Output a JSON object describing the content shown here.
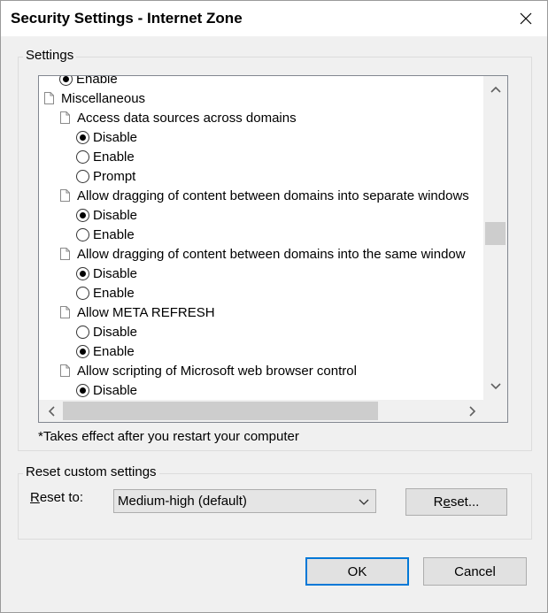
{
  "window": {
    "title": "Security Settings - Internet Zone"
  },
  "settings_group": {
    "label": "Settings",
    "tree": [
      {
        "type": "radio",
        "level": 1,
        "checked": true,
        "label": "Enable"
      },
      {
        "type": "doc",
        "level": 0,
        "label": "Miscellaneous"
      },
      {
        "type": "doc",
        "level": 1,
        "label": "Access data sources across domains"
      },
      {
        "type": "radio",
        "level": 2,
        "checked": true,
        "label": "Disable"
      },
      {
        "type": "radio",
        "level": 2,
        "checked": false,
        "label": "Enable"
      },
      {
        "type": "radio",
        "level": 2,
        "checked": false,
        "label": "Prompt"
      },
      {
        "type": "doc",
        "level": 1,
        "label": "Allow dragging of content between domains into separate windows"
      },
      {
        "type": "radio",
        "level": 2,
        "checked": true,
        "label": "Disable"
      },
      {
        "type": "radio",
        "level": 2,
        "checked": false,
        "label": "Enable"
      },
      {
        "type": "doc",
        "level": 1,
        "label": "Allow dragging of content between domains into the same window"
      },
      {
        "type": "radio",
        "level": 2,
        "checked": true,
        "label": "Disable"
      },
      {
        "type": "radio",
        "level": 2,
        "checked": false,
        "label": "Enable"
      },
      {
        "type": "doc",
        "level": 1,
        "label": "Allow META REFRESH"
      },
      {
        "type": "radio",
        "level": 2,
        "checked": false,
        "label": "Disable"
      },
      {
        "type": "radio",
        "level": 2,
        "checked": true,
        "label": "Enable"
      },
      {
        "type": "doc",
        "level": 1,
        "label": "Allow scripting of Microsoft web browser control"
      },
      {
        "type": "radio",
        "level": 2,
        "checked": true,
        "label": "Disable"
      }
    ],
    "note": "*Takes effect after you restart your computer"
  },
  "reset_group": {
    "label": "Reset custom settings",
    "reset_to_label_first": "R",
    "reset_to_label_rest": "eset to:",
    "selected_level": "Medium-high (default)",
    "reset_button_pre": "R",
    "reset_button_u": "e",
    "reset_button_post": "set..."
  },
  "buttons": {
    "ok": "OK",
    "cancel": "Cancel"
  },
  "icons": {
    "close": "close-icon",
    "scroll_up": "chevron-up-icon",
    "scroll_down": "chevron-down-icon",
    "scroll_left": "chevron-left-icon",
    "scroll_right": "chevron-right-icon",
    "dropdown": "chevron-down-icon",
    "tree_item": "document-icon"
  },
  "colors": {
    "default_button_border": "#0078d7",
    "dialog_background": "#f0f0f0"
  }
}
